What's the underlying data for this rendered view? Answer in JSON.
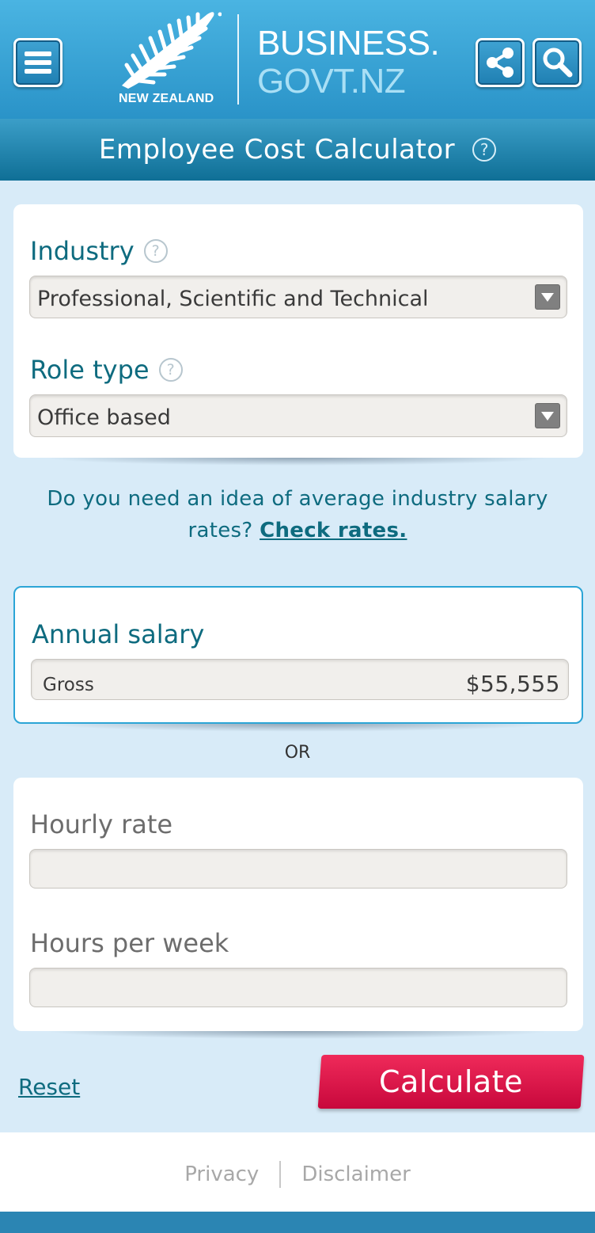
{
  "header": {
    "country_text": "NEW ZEALAND",
    "brand_line1": "BUSINESS.",
    "brand_line2": "GOVT.NZ",
    "icons": {
      "menu": "hamburger-menu-icon",
      "share": "share-icon",
      "search": "search-icon",
      "logo": "silver-fern-logo"
    }
  },
  "title_bar": {
    "title": "Employee Cost Calculator",
    "help_glyph": "?"
  },
  "industry_card": {
    "industry_label": "Industry",
    "industry_value": "Professional, Scientific and Technical",
    "role_label": "Role type",
    "role_value": "Office based",
    "help_glyph": "?"
  },
  "rates_prompt": {
    "text": "Do you need an idea of average industry salary rates?",
    "link": "Check rates."
  },
  "salary_card": {
    "label": "Annual salary",
    "field_label": "Gross",
    "field_value": "$55,555"
  },
  "or_text": "OR",
  "hourly_card": {
    "hourly_label": "Hourly rate",
    "hourly_value": "",
    "hours_label": "Hours per week",
    "hours_value": ""
  },
  "actions": {
    "reset": "Reset",
    "calculate": "Calculate"
  },
  "footer": {
    "privacy": "Privacy",
    "disclaimer": "Disclaimer"
  },
  "colors": {
    "header_blue": "#2a93c8",
    "title_bar_blue": "#0f6f96",
    "page_background": "#d8ebf8",
    "label_teal": "#0e6b7f",
    "calculate_red": "#d60f45",
    "salary_border": "#2ba5d6"
  }
}
